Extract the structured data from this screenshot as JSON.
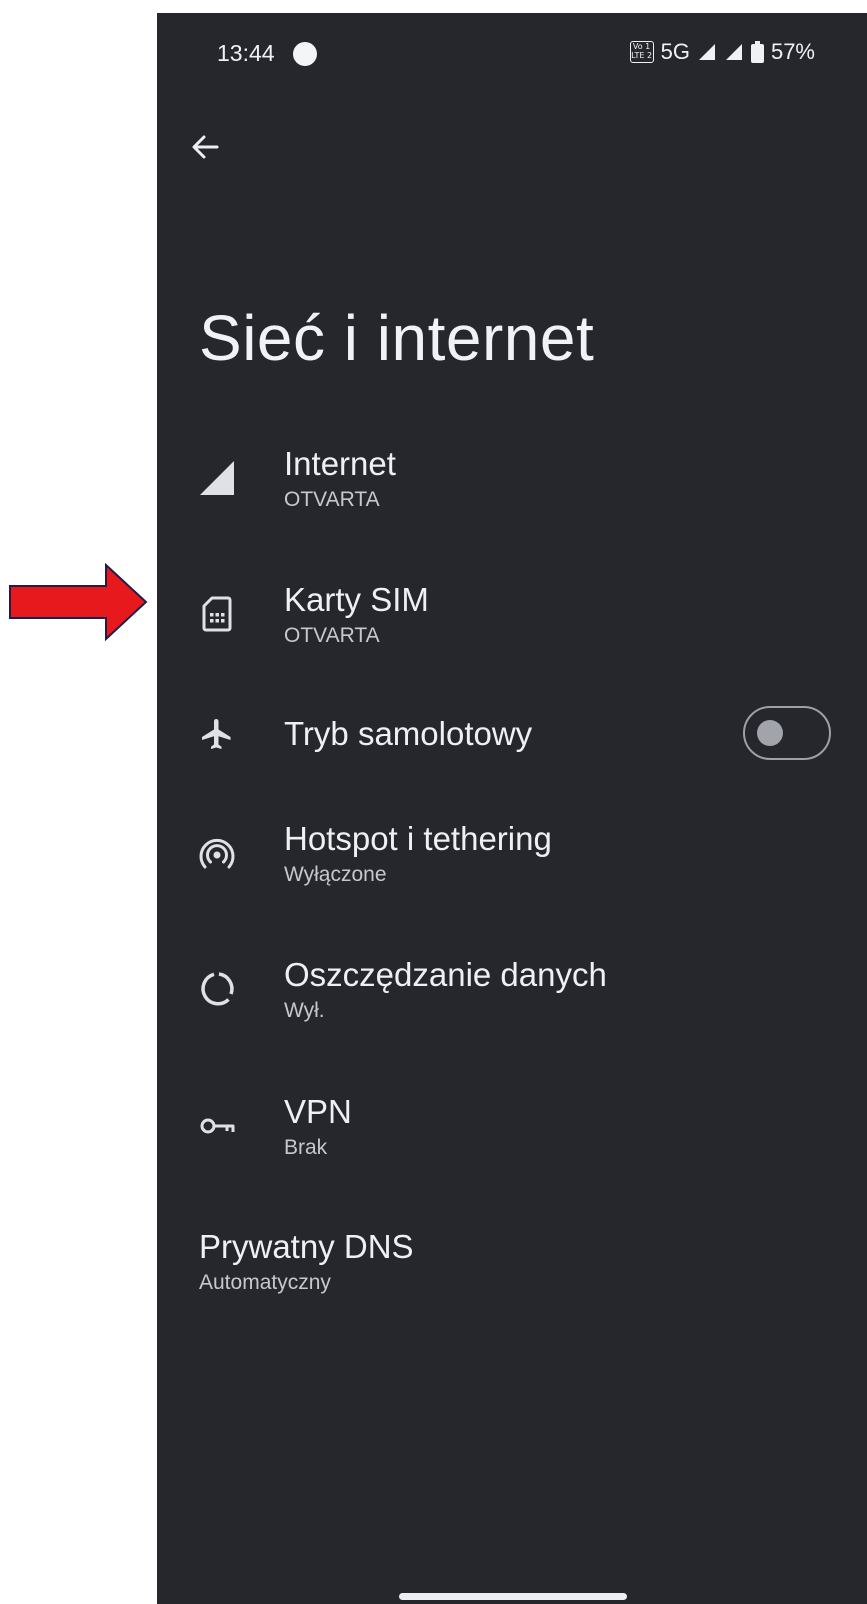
{
  "status_bar": {
    "time": "13:44",
    "volte_line1": "Vo 1",
    "volte_line2": "LTE 2",
    "network": "5G",
    "battery": "57%"
  },
  "header": {
    "back_icon": "arrow-back-icon",
    "title": "Sieć i internet"
  },
  "items": [
    {
      "icon": "signal-icon",
      "title": "Internet",
      "subtitle": "OTVARTA"
    },
    {
      "icon": "sim-card-icon",
      "title": "Karty SIM",
      "subtitle": "OTVARTA"
    },
    {
      "icon": "airplane-icon",
      "title": "Tryb samolotowy",
      "toggle_on": false
    },
    {
      "icon": "hotspot-icon",
      "title": "Hotspot i tethering",
      "subtitle": "Wyłączone"
    },
    {
      "icon": "data-saver-icon",
      "title": "Oszczędzanie danych",
      "subtitle": "Wył."
    },
    {
      "icon": "vpn-key-icon",
      "title": "VPN",
      "subtitle": "Brak"
    },
    {
      "title": "Prywatny DNS",
      "subtitle": "Automatyczny"
    }
  ],
  "annotation": {
    "icon": "red-arrow-pointer",
    "color": "#e8191c"
  },
  "colors": {
    "background": "#26272c",
    "text": "#eceef2",
    "subtext": "#c6c8cf"
  }
}
